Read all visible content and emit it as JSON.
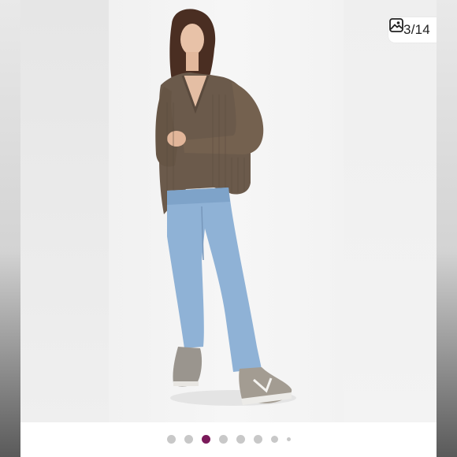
{
  "gallery": {
    "counter_text": "3/14",
    "counter_icon": "image-gallery-icon",
    "current_index": 3,
    "total_images": 14,
    "active_dot_color": "#7a1a5a",
    "inactive_dot_color": "#c8c8c8",
    "photo_subject": "model-wearing-brown-v-neck-sweater-and-light-blue-jeans"
  }
}
